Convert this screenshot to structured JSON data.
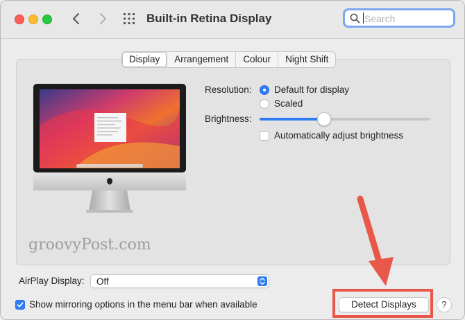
{
  "window": {
    "title": "Built-in Retina Display"
  },
  "search": {
    "placeholder": "Search"
  },
  "tabs": [
    {
      "label": "Display",
      "active": true
    },
    {
      "label": "Arrangement",
      "active": false
    },
    {
      "label": "Colour",
      "active": false
    },
    {
      "label": "Night Shift",
      "active": false
    }
  ],
  "resolution": {
    "label": "Resolution:",
    "options": [
      {
        "label": "Default for display",
        "selected": true
      },
      {
        "label": "Scaled",
        "selected": false
      }
    ]
  },
  "brightness": {
    "label": "Brightness:",
    "level": 0.38,
    "auto_label": "Automatically adjust brightness",
    "auto_checked": false
  },
  "airplay": {
    "label": "AirPlay Display:",
    "value": "Off"
  },
  "mirroring": {
    "label": "Show mirroring options in the menu bar when available",
    "checked": true
  },
  "buttons": {
    "detect_displays": "Detect Displays",
    "help": "?"
  },
  "watermark": "groovyPost.com",
  "colors": {
    "accent": "#2f7cf6",
    "annotation": "#e8584a"
  }
}
